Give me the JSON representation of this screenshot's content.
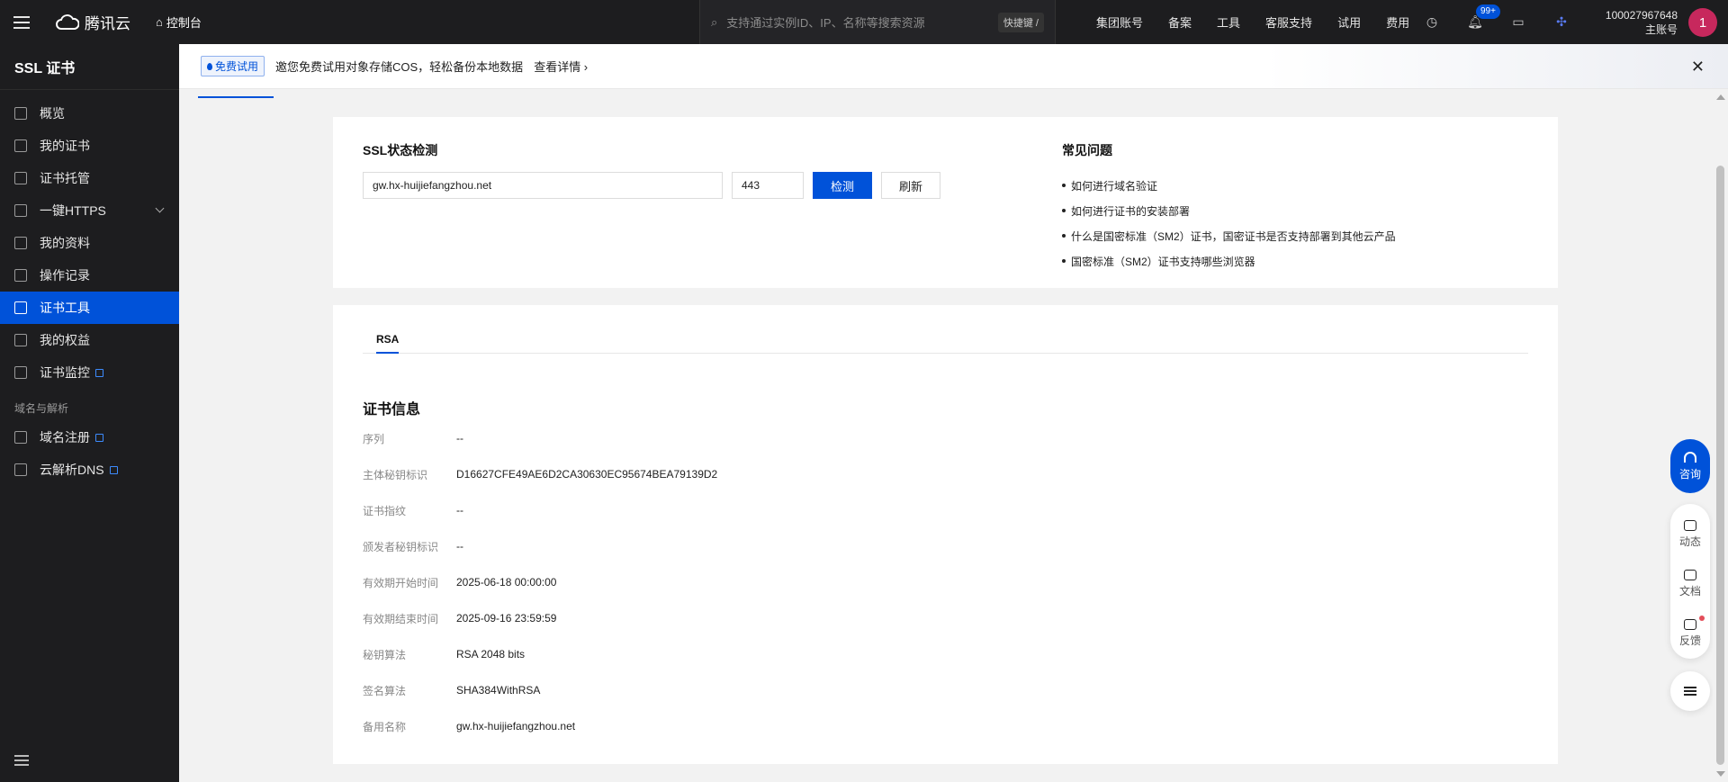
{
  "colors": {
    "brand": "#0052d9",
    "sidebar_bg": "#1d1d1f",
    "avatar": "#c7285d"
  },
  "topbar": {
    "logo": "腾讯云",
    "console": "控制台",
    "search_placeholder": "支持通过实例ID、IP、名称等搜索资源",
    "shortcut": "快捷键 /",
    "nav": [
      "集团账号",
      "备案",
      "工具",
      "客服支持",
      "试用",
      "费用"
    ],
    "notification_badge": "99+",
    "account_id": "100027967648",
    "account_role": "主账号",
    "avatar_text": "1"
  },
  "sidebar": {
    "title": "SSL 证书",
    "items": [
      {
        "label": "概览",
        "icon": "grid-icon"
      },
      {
        "label": "我的证书",
        "icon": "certificate-icon"
      },
      {
        "label": "证书托管",
        "icon": "hosting-icon"
      },
      {
        "label": "一键HTTPS",
        "icon": "sliders-icon"
      },
      {
        "label": "我的资料",
        "icon": "folder-icon"
      },
      {
        "label": "操作记录",
        "icon": "log-icon"
      },
      {
        "label": "证书工具",
        "icon": "tool-icon"
      },
      {
        "label": "我的权益",
        "icon": "gift-icon"
      },
      {
        "label": "证书监控",
        "icon": "monitor-icon"
      }
    ],
    "group_label": "域名与解析",
    "group_items": [
      {
        "label": "域名注册",
        "icon": "domain-icon"
      },
      {
        "label": "云解析DNS",
        "icon": "dns-icon"
      }
    ]
  },
  "banner": {
    "tag": "免费试用",
    "text": "邀您免费试用对象存储COS，轻松备份本地数据",
    "link": "查看详情 ›",
    "close": "✕"
  },
  "check": {
    "title": "SSL状态检测",
    "domain_value": "gw.hx-huijiefangzhou.net",
    "port_value": "443",
    "check_button": "检测",
    "refresh_button": "刷新"
  },
  "faq": {
    "title": "常见问题",
    "items": [
      "如何进行域名验证",
      "如何进行证书的安装部署",
      "什么是国密标准（SM2）证书，国密证书是否支持部署到其他云产品",
      "国密标准（SM2）证书支持哪些浏览器"
    ]
  },
  "result": {
    "tab": "RSA",
    "title": "证书信息",
    "rows": [
      {
        "key": "序列",
        "value": "--"
      },
      {
        "key": "主体秘钥标识",
        "value": "D16627CFE49AE6D2CA30630EC95674BEA79139D2"
      },
      {
        "key": "证书指纹",
        "value": "--"
      },
      {
        "key": "颁发者秘钥标识",
        "value": "--"
      },
      {
        "key": "有效期开始时间",
        "value": "2025-06-18 00:00:00"
      },
      {
        "key": "有效期结束时间",
        "value": "2025-09-16 23:59:59"
      },
      {
        "key": "秘钥算法",
        "value": "RSA 2048 bits"
      },
      {
        "key": "签名算法",
        "value": "SHA384WithRSA"
      },
      {
        "key": "备用名称",
        "value": "gw.hx-huijiefangzhou.net"
      }
    ]
  },
  "float": {
    "consult": "咨询",
    "items": [
      "动态",
      "文档",
      "反馈"
    ]
  }
}
